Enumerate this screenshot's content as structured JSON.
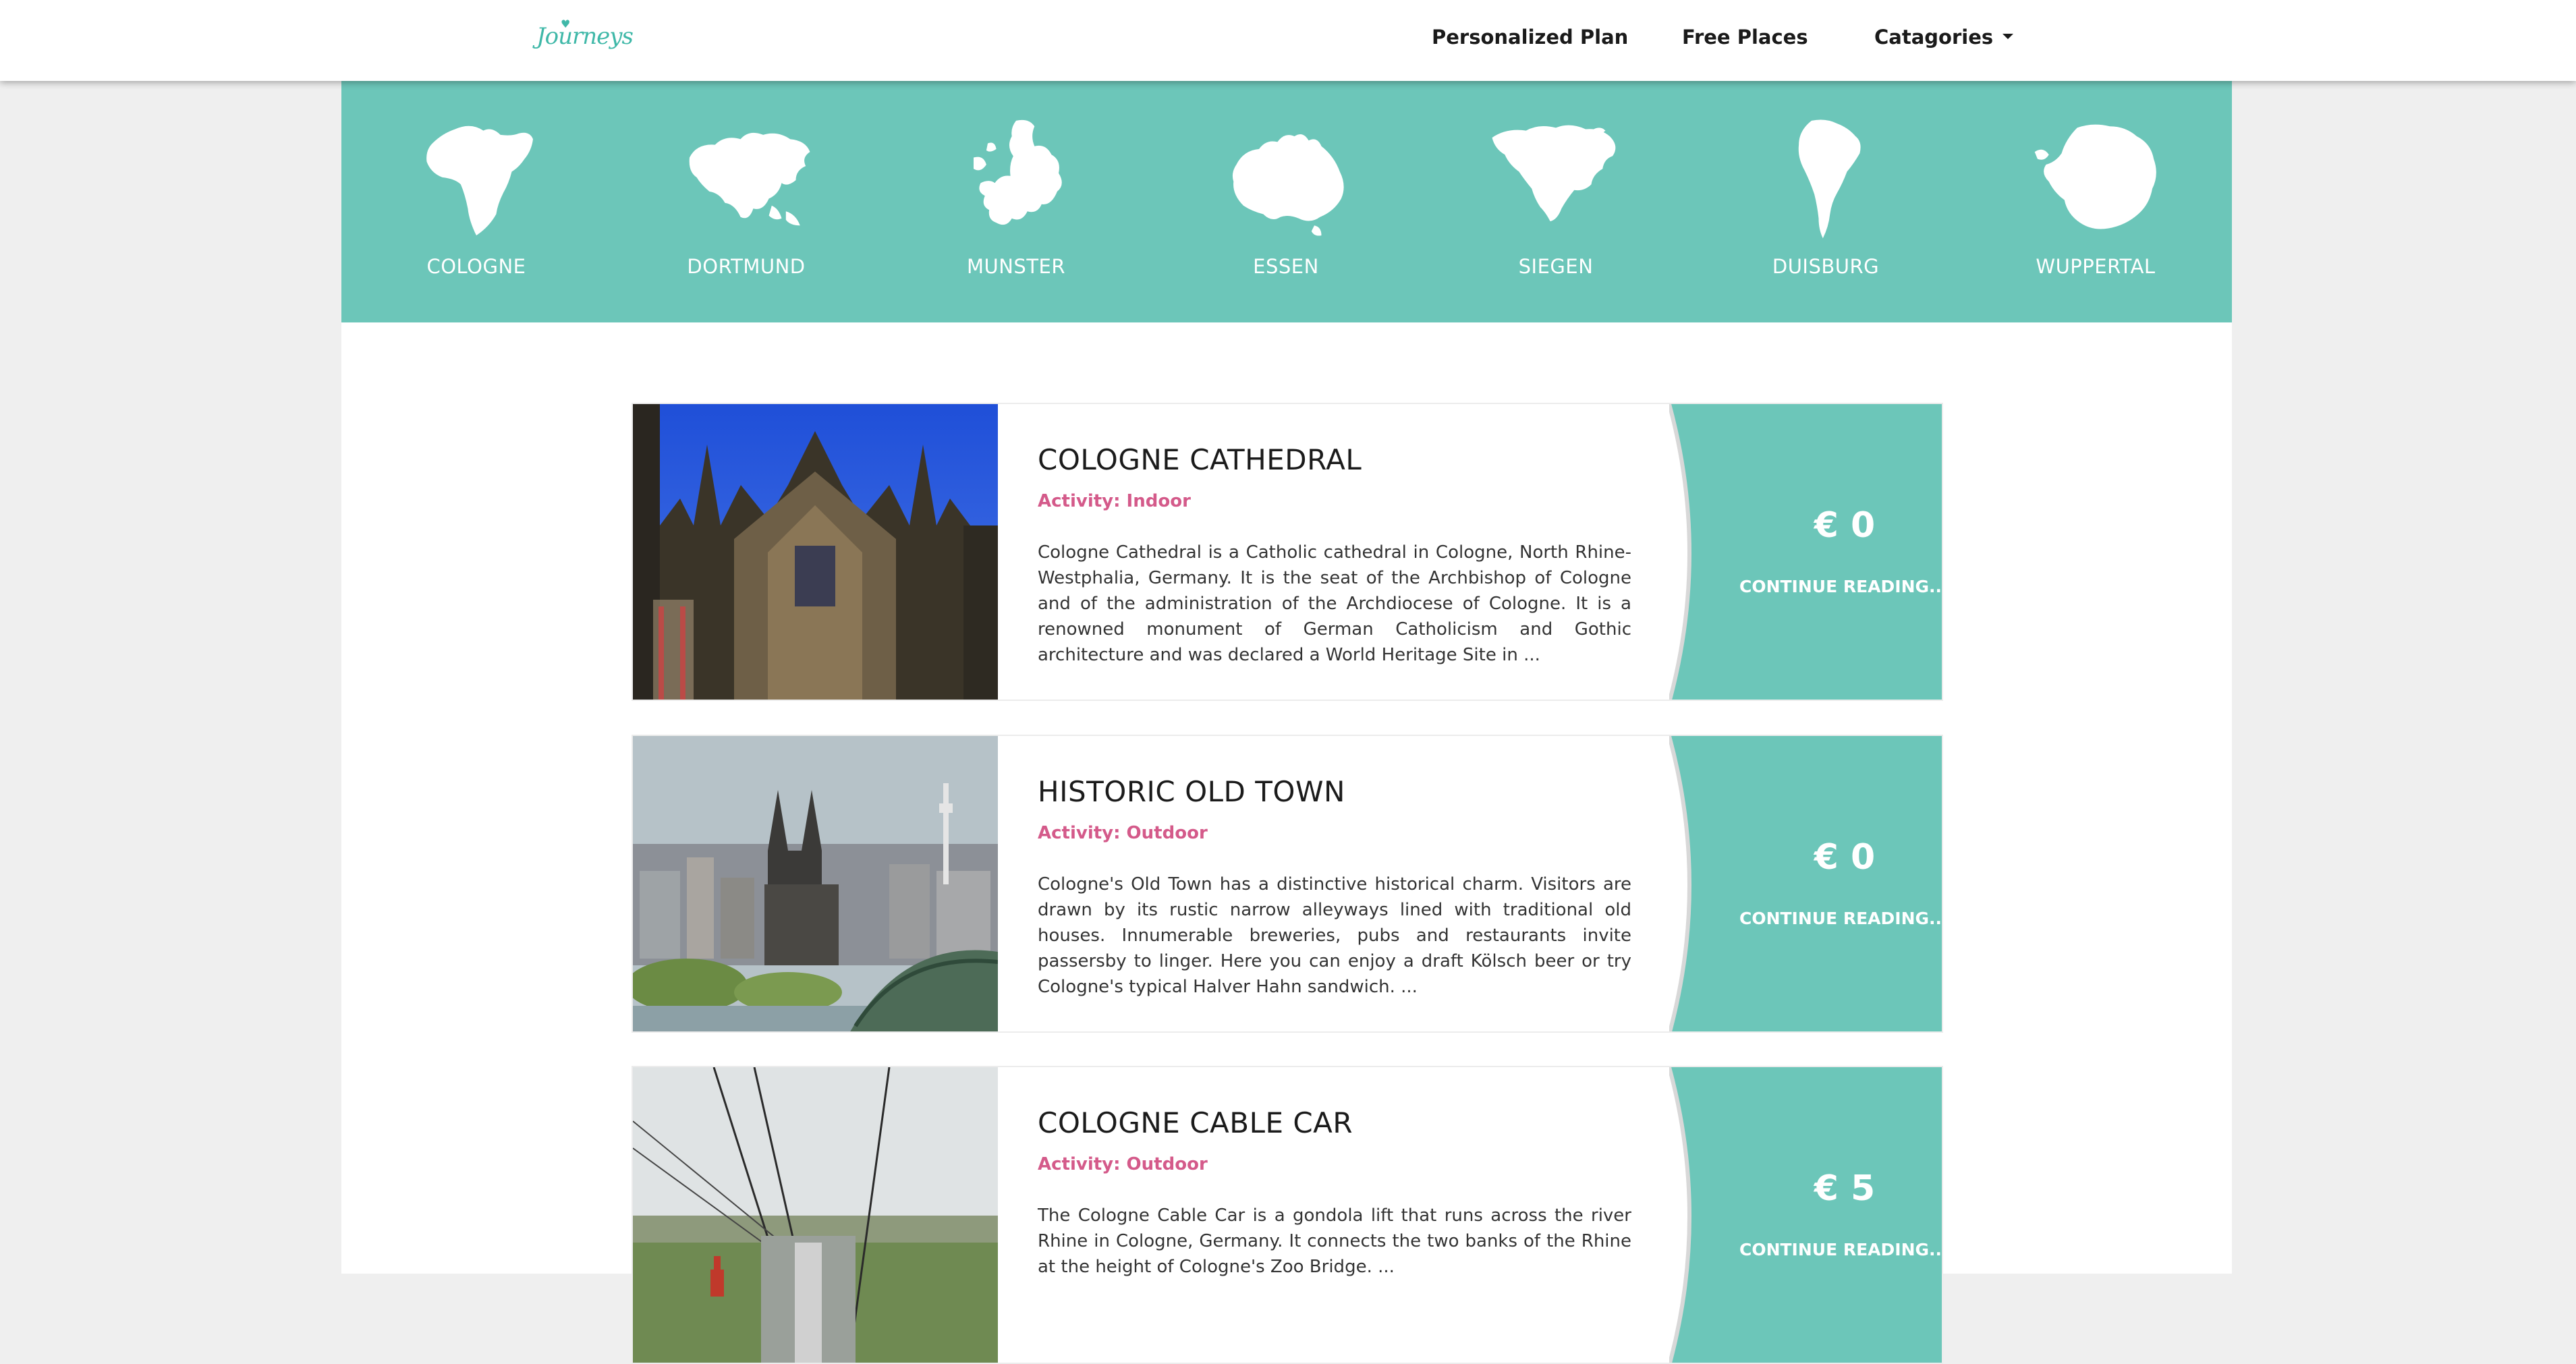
{
  "brand": {
    "logo_text": "Journeys"
  },
  "nav": {
    "items": [
      {
        "label": "Personalized Plan"
      },
      {
        "label": "Free Places"
      },
      {
        "label": "Catagories"
      }
    ]
  },
  "continents": [
    {
      "label": "COLOGNE",
      "icon": "africa-icon"
    },
    {
      "label": "DORTMUND",
      "icon": "asia-icon"
    },
    {
      "label": "MUNSTER",
      "icon": "europe-icon"
    },
    {
      "label": "ESSEN",
      "icon": "australia-icon"
    },
    {
      "label": "SIEGEN",
      "icon": "north-america-icon"
    },
    {
      "label": "DUISBURG",
      "icon": "south-america-icon"
    },
    {
      "label": "WUPPERTAL",
      "icon": "antarctica-icon"
    }
  ],
  "colors": {
    "accent": "#6cc6b9",
    "activity": "#d45a8a",
    "logo": "#3fb8a8"
  },
  "places": [
    {
      "title": "COLOGNE CATHEDRAL",
      "activity": "Activity: Indoor",
      "description": "Cologne Cathedral is a Catholic cathedral in Cologne, North Rhine-Westphalia, Germany. It is the seat of the Archbishop of Cologne and of the administration of the Archdiocese of Cologne. It is a renowned monument of German Catholicism and Gothic architecture and was declared a World Heritage Site in ...",
      "price": "€ 0",
      "cta": "CONTINUE READING.."
    },
    {
      "title": "HISTORIC OLD TOWN",
      "activity": "Activity: Outdoor",
      "description": "Cologne's Old Town has a distinctive historical charm. Visitors are drawn by its rustic narrow alleyways lined with traditional old houses. Innumerable breweries, pubs and restaurants invite passersby to linger. Here you can enjoy a draft Kölsch beer or try Cologne's typical Halver Hahn sandwich. ...",
      "price": "€ 0",
      "cta": "CONTINUE READING.."
    },
    {
      "title": "COLOGNE CABLE CAR",
      "activity": "Activity: Outdoor",
      "description": "The Cologne Cable Car is a gondola lift that runs across the river Rhine in Cologne, Germany. It connects the two banks of the Rhine at the height of Cologne's Zoo Bridge. ...",
      "price": "€ 5",
      "cta": "CONTINUE READING.."
    }
  ]
}
